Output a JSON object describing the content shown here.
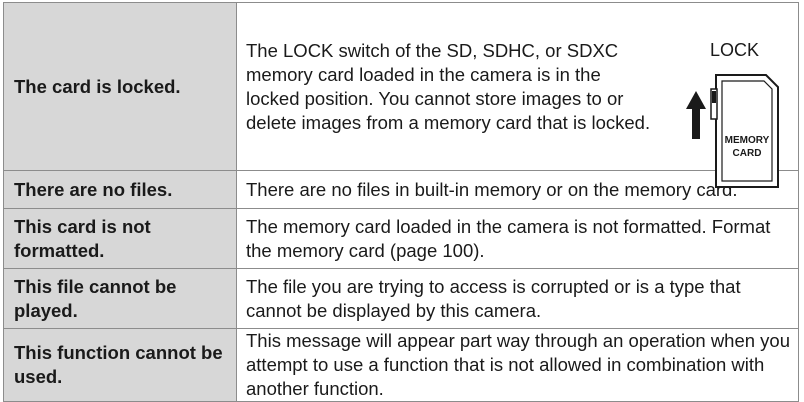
{
  "rows": [
    {
      "term": "The card is locked.",
      "desc": "The LOCK switch of the SD, SDHC, or SDXC memory card loaded in the camera is in the locked position. You cannot store images to or delete images from a memory card that is locked."
    },
    {
      "term": "There are no files.",
      "desc": "There are no files in built-in memory or on the memory card."
    },
    {
      "term": "This card is not formatted.",
      "desc": "The memory card loaded in the camera is not formatted. Format the memory card (page 100)."
    },
    {
      "term": "This file cannot be played.",
      "desc": "The file you are trying to access is corrupted or is a type that cannot be displayed by this camera."
    },
    {
      "term": "This function cannot be used.",
      "desc": "This message will appear part way through an operation when you attempt to use a function that is not allowed in combination with another function."
    }
  ],
  "lock_figure": {
    "caption": "LOCK",
    "card_line1": "MEMORY",
    "card_line2": "CARD",
    "icon": "sd-card-lock-icon"
  }
}
